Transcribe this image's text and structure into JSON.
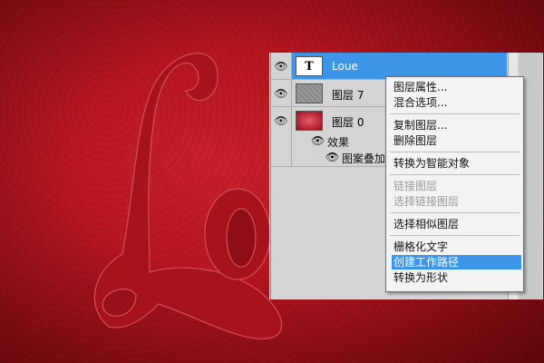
{
  "layers_panel": {
    "layers": [
      {
        "name": "Loue",
        "thumb": "T",
        "selected": true
      },
      {
        "name": "图层 7",
        "selected": false
      },
      {
        "name": "图层 0",
        "selected": false
      }
    ],
    "effects_label": "效果",
    "effect_item": "图案叠加"
  },
  "context_menu": {
    "groups": [
      [
        "图层属性...",
        "混合选项..."
      ],
      [
        "复制图层...",
        "删除图层"
      ],
      [
        "转换为智能对象"
      ],
      [
        "链接图层",
        "选择链接图层"
      ],
      [
        "选择相似图层"
      ],
      [
        "栅格化文字",
        "创建工作路径",
        "转换为形状"
      ]
    ],
    "disabled": [
      "链接图层",
      "选择链接图层"
    ],
    "highlighted": "创建工作路径"
  },
  "canvas": {
    "text": "Lo",
    "background_color": "#b3141d",
    "letter_color": "#a8141c"
  }
}
